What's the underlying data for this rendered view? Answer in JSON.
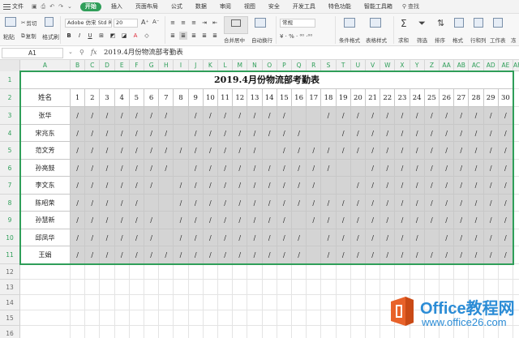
{
  "menubar": {
    "file_label": "文件",
    "tabs": [
      "开始",
      "插入",
      "页面布局",
      "公式",
      "数据",
      "审阅",
      "视图",
      "安全",
      "开发工具",
      "特色功能",
      "智能工具箱"
    ],
    "active_tab": "开始",
    "search_label": "查找"
  },
  "ribbon": {
    "cut": "剪切",
    "copy": "复制",
    "paste": "粘贴",
    "format_painter": "格式刷",
    "font_name": "Adobe 仿宋 Std R",
    "font_size": "20",
    "merge_center": "合并居中",
    "wrap_text": "自动换行",
    "number_format": "常规",
    "conditional_format": "条件格式",
    "table_style": "表格样式",
    "sum": "求和",
    "filter": "筛选",
    "sort": "排序",
    "format": "格式",
    "fill": "行和列",
    "worksheet": "工作表",
    "freeze": "冻"
  },
  "formula_bar": {
    "cell_ref": "A1",
    "fx_label": "fx",
    "formula": "2019.4月份物流部考勤表"
  },
  "sheet": {
    "column_letters": [
      "A",
      "B",
      "C",
      "D",
      "E",
      "F",
      "G",
      "H",
      "I",
      "J",
      "K",
      "L",
      "M",
      "N",
      "O",
      "P",
      "Q",
      "R",
      "S",
      "T",
      "U",
      "V",
      "W",
      "X",
      "Y",
      "Z",
      "AA",
      "AB",
      "AC",
      "AD",
      "AE",
      "AF"
    ],
    "row_numbers": [
      "1",
      "2",
      "3",
      "4",
      "5",
      "6",
      "7",
      "8",
      "9",
      "10",
      "11",
      "12",
      "13",
      "14",
      "15",
      "16"
    ],
    "title": "2019.4月份物流部考勤表",
    "name_header": "姓名",
    "day_headers": [
      "1",
      "2",
      "3",
      "4",
      "5",
      "6",
      "7",
      "8",
      "9",
      "10",
      "11",
      "12",
      "13",
      "14",
      "15",
      "16",
      "17",
      "18",
      "19",
      "20",
      "21",
      "22",
      "23",
      "24",
      "25",
      "26",
      "27",
      "28",
      "29",
      "30"
    ],
    "employees": [
      {
        "name": "张华",
        "marks": [
          "/",
          "/",
          "/",
          "/",
          "/",
          "/",
          "/",
          "",
          "/",
          "/",
          "/",
          "/",
          "/",
          "/",
          "/",
          "",
          "",
          "/",
          "/",
          "/",
          "/",
          "/",
          "/",
          "/",
          "/",
          "/",
          "/",
          "/",
          "/",
          "/"
        ]
      },
      {
        "name": "宋兆东",
        "marks": [
          "/",
          "/",
          "/",
          "/",
          "/",
          "/",
          "/",
          "",
          "/",
          "/",
          "/",
          "/",
          "/",
          "/",
          "/",
          "/",
          "",
          "",
          "/",
          "/",
          "/",
          "/",
          "/",
          "/",
          "/",
          "/",
          "/",
          "/",
          "/",
          "/"
        ]
      },
      {
        "name": "范文芳",
        "marks": [
          "/",
          "/",
          "/",
          "/",
          "/",
          "/",
          "/",
          "/",
          "/",
          "/",
          "/",
          "/",
          "/",
          "",
          "/",
          "/",
          "/",
          "/",
          "/",
          "/",
          "/",
          "/",
          "/",
          "/",
          "/",
          "/",
          "/",
          "/",
          "/",
          "/"
        ]
      },
      {
        "name": "孙亮鼓",
        "marks": [
          "/",
          "/",
          "/",
          "/",
          "/",
          "/",
          "/",
          "",
          "/",
          "/",
          "/",
          "/",
          "/",
          "/",
          "/",
          "/",
          "/",
          "/",
          "",
          "",
          "/",
          "/",
          "/",
          "/",
          "/",
          "/",
          "/",
          "/",
          "/",
          "/"
        ]
      },
      {
        "name": "李文东",
        "marks": [
          "/",
          "/",
          "/",
          "/",
          "/",
          "/",
          "",
          "/",
          "/",
          "/",
          "/",
          "/",
          "/",
          "/",
          "/",
          "/",
          "/",
          "",
          "",
          "/",
          "/",
          "/",
          "/",
          "/",
          "/",
          "/",
          "/",
          "/",
          "/",
          "/"
        ]
      },
      {
        "name": "陈昭荣",
        "marks": [
          "/",
          "/",
          "/",
          "/",
          "/",
          "",
          "",
          "/",
          "/",
          "/",
          "/",
          "/",
          "/",
          "/",
          "/",
          "/",
          "/",
          "/",
          "/",
          "/",
          "/",
          "/",
          "/",
          "/",
          "/",
          "/",
          "/",
          "/",
          "/",
          "/"
        ]
      },
      {
        "name": "孙慧新",
        "marks": [
          "/",
          "/",
          "/",
          "/",
          "/",
          "/",
          "",
          "/",
          "/",
          "/",
          "/",
          "/",
          "/",
          "/",
          "/",
          "",
          "/",
          "/",
          "/",
          "/",
          "/",
          "/",
          "/",
          "/",
          "/",
          "/",
          "/",
          "/",
          "/",
          "/"
        ]
      },
      {
        "name": "邱凤华",
        "marks": [
          "/",
          "/",
          "/",
          "/",
          "/",
          "/",
          "",
          "/",
          "/",
          "/",
          "/",
          "/",
          "/",
          "/",
          "/",
          "/",
          "",
          "/",
          "/",
          "/",
          "/",
          "/",
          "/",
          "/",
          "",
          "/",
          "/",
          "/",
          "/",
          "/"
        ]
      },
      {
        "name": "王娟",
        "marks": [
          "/",
          "/",
          "/",
          "/",
          "/",
          "/",
          "/",
          "/",
          "/",
          "/",
          "/",
          "/",
          "/",
          "/",
          "/",
          "/",
          "",
          "/",
          "/",
          "/",
          "/",
          "/",
          "/",
          "/",
          "/",
          "/",
          "/",
          "/",
          "/",
          "/"
        ]
      }
    ]
  },
  "watermark": {
    "title": "Office教程网",
    "url": "www.office26.com",
    "primary_color": "#2b8cd6",
    "accent_color": "#e8622a"
  },
  "colors": {
    "accent_green": "#2f9e59",
    "data_fill": "#d4d4d4"
  }
}
